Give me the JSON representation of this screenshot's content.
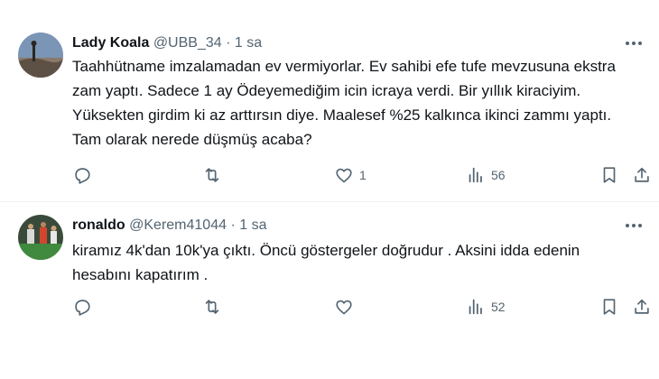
{
  "tweets": [
    {
      "name": "Lady Koala",
      "handle": "@UBB_34",
      "dot": "·",
      "time": "1 sa",
      "text": "Taahhütname imzalamadan ev vermiyorlar. Ev sahibi efe tufe mevzusuna ekstra zam yaptı. Sadece 1 ay Ödeyemediğim icin icraya verdi. Bir yıllık kiraciyim. Yüksekten girdim ki az arttırsın diye. Maalesef %25 kalkınca ikinci zammı yaptı. Tam olarak nerede düşmüş acaba?",
      "likes": "1",
      "views": "56",
      "icons": [
        "reply-icon",
        "retweet-icon",
        "like-icon",
        "views-icon",
        "bookmark-icon",
        "share-icon"
      ]
    },
    {
      "name": "ronaldo",
      "handle": "@Kerem41044",
      "dot": "·",
      "time": "1 sa",
      "text": "kiramız 4k'dan 10k'ya çıktı. Öncü göstergeler doğrudur . Aksini idda edenin hesabını kapatırım .",
      "likes": "",
      "views": "52",
      "icons": [
        "reply-icon",
        "retweet-icon",
        "like-icon",
        "views-icon",
        "bookmark-icon",
        "share-icon"
      ]
    }
  ],
  "colors": {
    "text": "#0f1419",
    "secondary": "#536471",
    "border": "#eff3f4"
  }
}
